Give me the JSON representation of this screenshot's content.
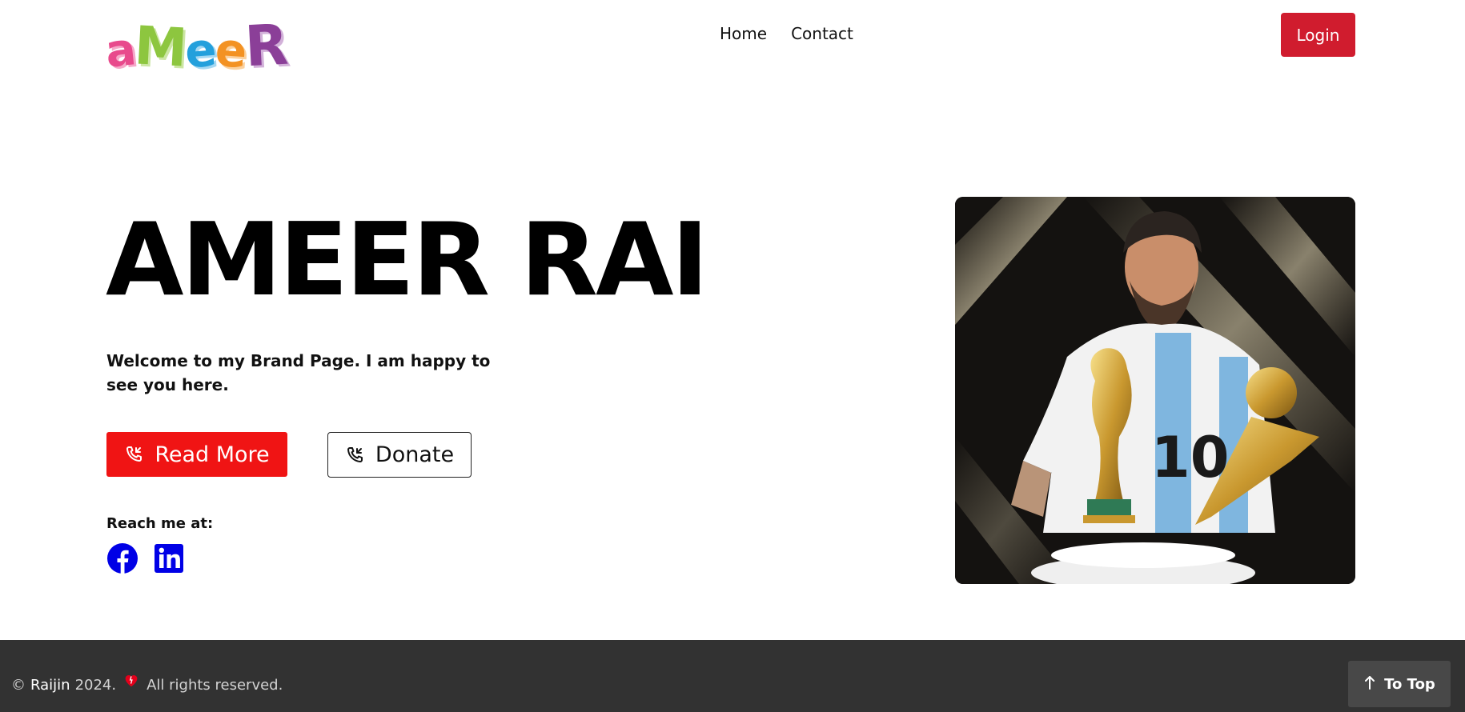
{
  "header": {
    "logo_text": "aMeeR",
    "logo_letters": [
      "a",
      "M",
      "e",
      "e",
      "R"
    ],
    "nav": [
      {
        "label": "Home"
      },
      {
        "label": "Contact"
      }
    ],
    "login_label": "Login"
  },
  "hero": {
    "title": "AMEER RAI",
    "subtitle": "Welcome to my Brand Page. I am happy to see you here.",
    "read_more_label": "Read More",
    "donate_label": "Donate",
    "reach_label": "Reach me at:",
    "social": [
      {
        "icon": "facebook-icon",
        "color": "#0000e6"
      },
      {
        "icon": "linkedin-icon",
        "color": "#0000e6"
      }
    ],
    "image": {
      "icon": "player-with-trophy-photo"
    }
  },
  "footer": {
    "copyright_symbol": "©",
    "brand": "Raijin",
    "year": "2024.",
    "rights": "All rights reserved.",
    "to_top_label": "To Top"
  },
  "colors": {
    "login_bg": "#d01c2e",
    "read_more_bg": "#f01414",
    "footer_bg": "#323232",
    "to_top_bg": "#484848",
    "social_blue": "#0000e6",
    "heart_red": "#e3001b"
  }
}
